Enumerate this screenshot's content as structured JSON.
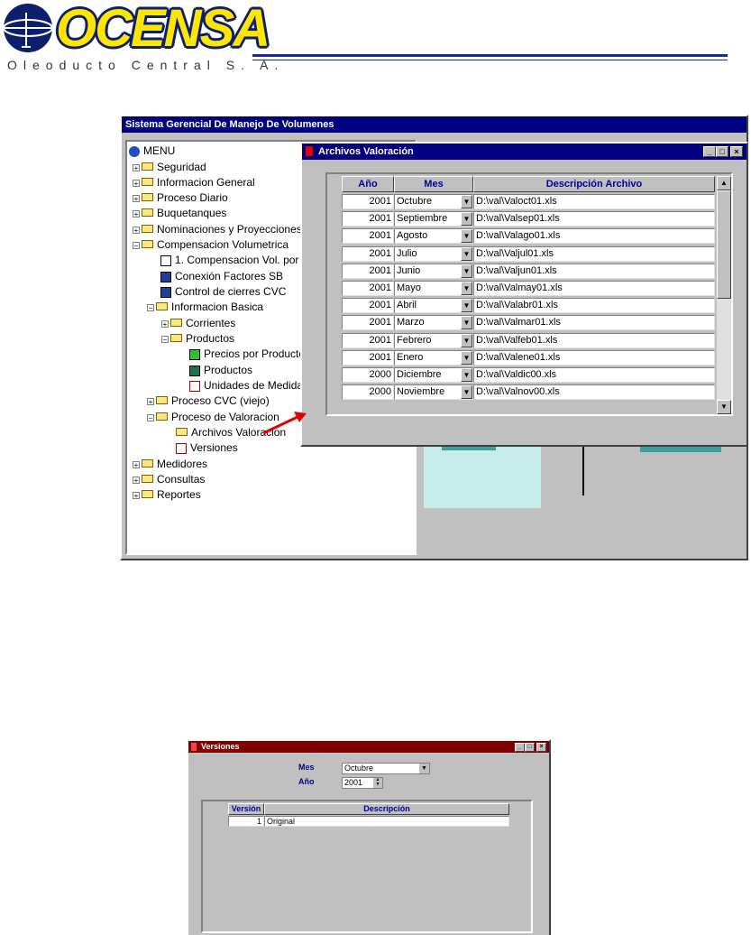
{
  "header": {
    "logo_text": "OCENSA",
    "subtitle": "Oleoducto Central S. A.",
    "rule_color": "#1a2a9a"
  },
  "main_window": {
    "title": "Sistema Gerencial De Manejo De Volumenes",
    "tree": {
      "root": "MENU",
      "items": [
        {
          "label": "Seguridad"
        },
        {
          "label": "Informacion General"
        },
        {
          "label": "Proceso Diario"
        },
        {
          "label": "Buquetanques"
        },
        {
          "label": "Nominaciones y Proyecciones"
        },
        {
          "label": "Compensacion Volumetrica"
        },
        {
          "label": "1. Compensacion Vol. por C"
        },
        {
          "label": "Conexión Factores SB"
        },
        {
          "label": "Control de cierres CVC"
        },
        {
          "label": "Informacion Basica"
        },
        {
          "label": "Corrientes"
        },
        {
          "label": "Productos"
        },
        {
          "label": "Precios por Producto"
        },
        {
          "label": "Productos"
        },
        {
          "label": "Unidades de Medida"
        },
        {
          "label": "Proceso CVC (viejo)"
        },
        {
          "label": "Proceso de Valoracion"
        },
        {
          "label": "Archivos Valoracion"
        },
        {
          "label": "Versiones"
        },
        {
          "label": "Medidores"
        },
        {
          "label": "Consultas"
        },
        {
          "label": "Reportes"
        }
      ]
    }
  },
  "archivos_window": {
    "title": "Archivos Valoración",
    "columns": {
      "anio": "Año",
      "mes": "Mes",
      "desc": "Descripción Archivo"
    },
    "rows": [
      {
        "anio": "2001",
        "mes": "Octubre",
        "desc": "D:\\val\\Valoct01.xls"
      },
      {
        "anio": "2001",
        "mes": "Septiembre",
        "desc": "D:\\val\\Valsep01.xls"
      },
      {
        "anio": "2001",
        "mes": "Agosto",
        "desc": "D:\\val\\Valago01.xls"
      },
      {
        "anio": "2001",
        "mes": "Julio",
        "desc": "D:\\val\\Valjul01.xls"
      },
      {
        "anio": "2001",
        "mes": "Junio",
        "desc": "D:\\val\\Valjun01.xls"
      },
      {
        "anio": "2001",
        "mes": "Mayo",
        "desc": "D:\\val\\Valmay01.xls"
      },
      {
        "anio": "2001",
        "mes": "Abril",
        "desc": "D:\\val\\Valabr01.xls"
      },
      {
        "anio": "2001",
        "mes": "Marzo",
        "desc": "D:\\val\\Valmar01.xls"
      },
      {
        "anio": "2001",
        "mes": "Febrero",
        "desc": "D:\\val\\Valfeb01.xls"
      },
      {
        "anio": "2001",
        "mes": "Enero",
        "desc": "D:\\val\\Valene01.xls"
      },
      {
        "anio": "2000",
        "mes": "Diciembre",
        "desc": "D:\\val\\Valdic00.xls"
      },
      {
        "anio": "2000",
        "mes": "Noviembre",
        "desc": "D:\\val\\Valnov00.xls"
      }
    ]
  },
  "versiones_window": {
    "title": "Versiones",
    "mes_label": "Mes",
    "mes_value": "Octubre",
    "anio_label": "Año",
    "anio_value": "2001",
    "columns": {
      "version": "Versión",
      "desc": "Descripción"
    },
    "rows": [
      {
        "version": "1",
        "desc": "Original"
      }
    ]
  },
  "colors": {
    "titlebar_active": "#000080",
    "titlebar_versiones": "#800000",
    "arrow": "#e00000"
  }
}
